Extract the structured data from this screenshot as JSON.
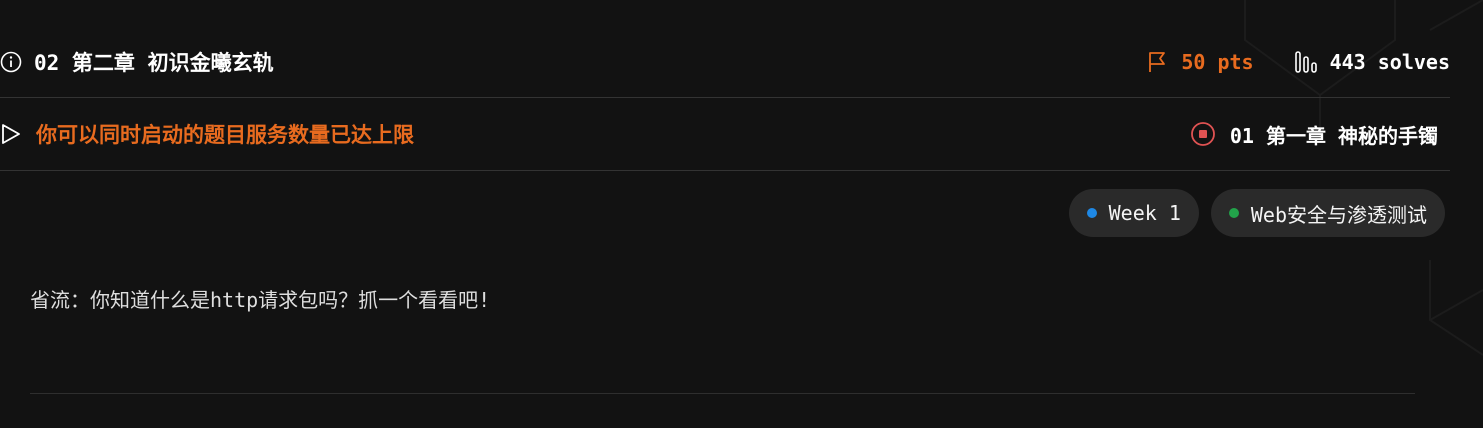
{
  "challenge": {
    "title": "02 第二章 初识金曦玄轨",
    "points": "50 pts",
    "solves": "443 solves"
  },
  "launch": {
    "label": "你可以同时启动的题目服务数量已达上限",
    "running_instance": "01 第一章 神秘的手镯"
  },
  "tags": [
    {
      "label": "Week 1",
      "color": "#1e88e5"
    },
    {
      "label": "Web安全与渗透测试",
      "color": "#22a34a"
    }
  ],
  "description": "省流：你知道什么是http请求包吗？抓一个看看吧!",
  "colors": {
    "accent": "#e86b1f",
    "stop": "#e05353",
    "background": "#121212"
  },
  "icons": {
    "info": "info-icon",
    "flag": "flag-icon",
    "solves": "bar-chart-icon",
    "play": "play-icon",
    "stop": "stop-icon"
  }
}
